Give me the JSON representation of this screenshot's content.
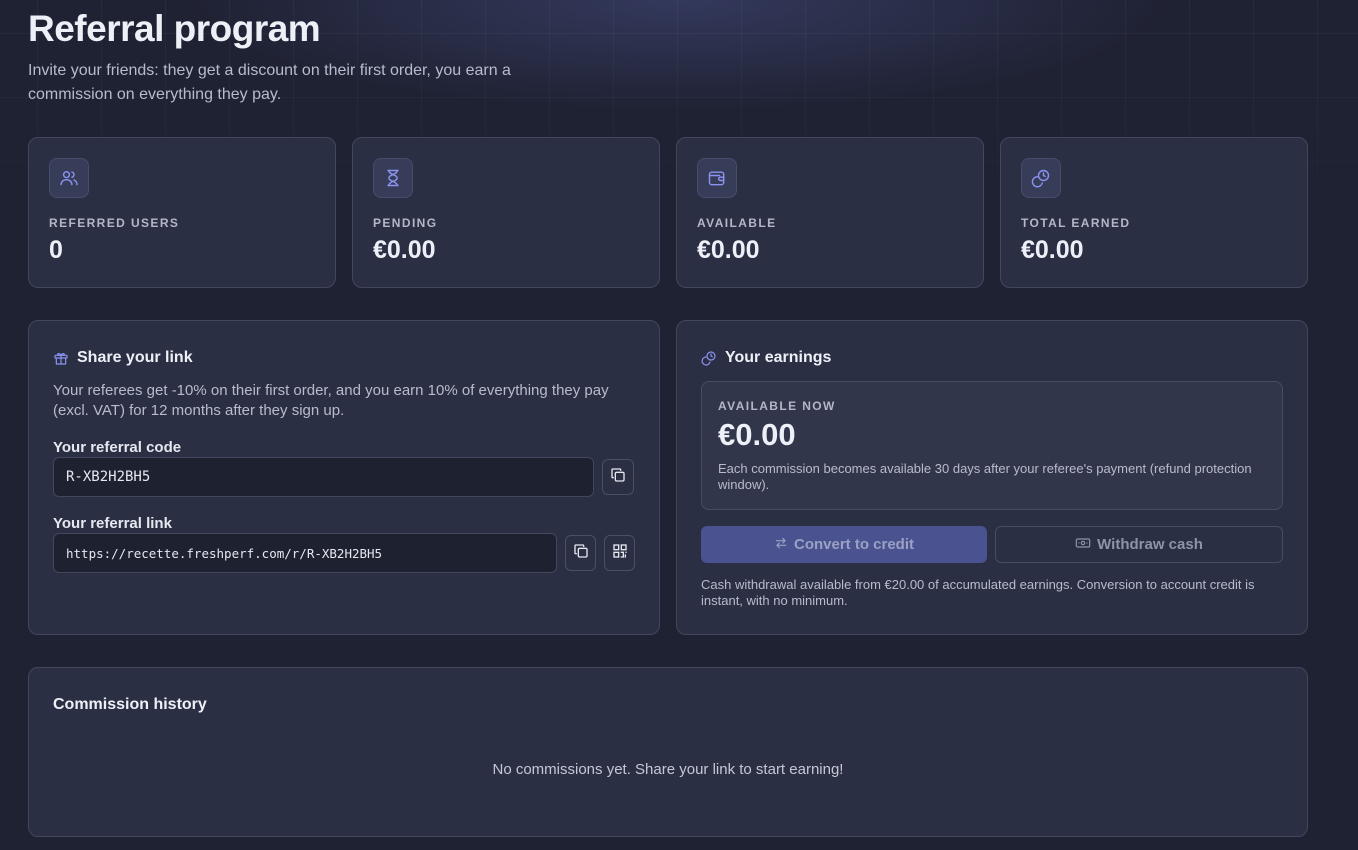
{
  "header": {
    "title": "Referral program",
    "subtitle": "Invite your friends: they get a discount on their first order, you earn a commission on everything they pay."
  },
  "stats": [
    {
      "label": "REFERRED USERS",
      "value": "0",
      "icon": "users-icon"
    },
    {
      "label": "PENDING",
      "value": "€0.00",
      "icon": "hourglass-icon"
    },
    {
      "label": "AVAILABLE",
      "value": "€0.00",
      "icon": "wallet-icon"
    },
    {
      "label": "TOTAL EARNED",
      "value": "€0.00",
      "icon": "coins-icon"
    }
  ],
  "share": {
    "title": "Share your link",
    "description": "Your referees get -10% on their first order, and you earn 10% of everything they pay (excl. VAT) for 12 months after they sign up.",
    "code_label": "Your referral code",
    "code_value": "R-XB2H2BH5",
    "link_label": "Your referral link",
    "link_value": "https://recette.freshperf.com/r/R-XB2H2BH5"
  },
  "earnings": {
    "title": "Your earnings",
    "available_label": "AVAILABLE NOW",
    "available_value": "€0.00",
    "available_note": "Each commission becomes available 30 days after your referee's payment (refund protection window).",
    "convert_label": "Convert to credit",
    "withdraw_label": "Withdraw cash",
    "footnote": "Cash withdrawal available from €20.00 of accumulated earnings. Conversion to account credit is instant, with no minimum."
  },
  "history": {
    "title": "Commission history",
    "empty_text": "No commissions yet. Share your link to start earning!"
  },
  "colors": {
    "background": "#1f2233",
    "card": "#2b2f43",
    "accent": "#8b93f0",
    "primary_button": "#4a5390"
  }
}
